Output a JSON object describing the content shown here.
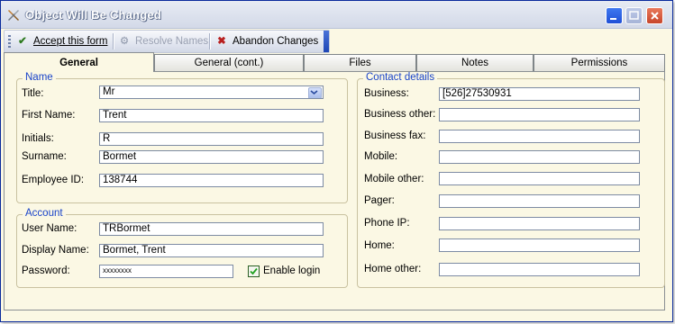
{
  "window": {
    "title": "Object Will Be Changed"
  },
  "toolbar": {
    "accept_label": "Accept this form",
    "resolve_label": "Resolve Names",
    "abandon_label": "Abandon Changes"
  },
  "tabs": [
    {
      "label": "General"
    },
    {
      "label": "General (cont.)"
    },
    {
      "label": "Files"
    },
    {
      "label": "Notes"
    },
    {
      "label": "Permissions"
    }
  ],
  "name_group": {
    "legend": "Name",
    "title_label": "Title:",
    "title_value": "Mr",
    "first_name_label": "First Name:",
    "first_name_value": "Trent",
    "initials_label": "Initials:",
    "initials_value": "R",
    "surname_label": "Surname:",
    "surname_value": "Bormet",
    "employee_id_label": "Employee ID:",
    "employee_id_value": "138744"
  },
  "account_group": {
    "legend": "Account",
    "user_name_label": "User Name:",
    "user_name_value": "TRBormet",
    "display_name_label": "Display Name:",
    "display_name_value": "Bormet, Trent",
    "password_label": "Password:",
    "password_value": "xxxxxxxx",
    "enable_login_label": "Enable login",
    "enable_login_checked": true
  },
  "contact_group": {
    "legend": "Contact details",
    "business_label": "Business:",
    "business_value": "[526]27530931",
    "business_other_label": "Business other:",
    "business_other_value": "",
    "business_fax_label": "Business fax:",
    "business_fax_value": "",
    "mobile_label": "Mobile:",
    "mobile_value": "",
    "mobile_other_label": "Mobile other:",
    "mobile_other_value": "",
    "pager_label": "Pager:",
    "pager_value": "",
    "phone_ip_label": "Phone IP:",
    "phone_ip_value": "",
    "home_label": "Home:",
    "home_value": "",
    "home_other_label": "Home other:",
    "home_other_value": ""
  },
  "colors": {
    "window_bg": "#fbf8e4",
    "legend_text": "#1a44c9",
    "title_bar": "#dfe4ef"
  }
}
